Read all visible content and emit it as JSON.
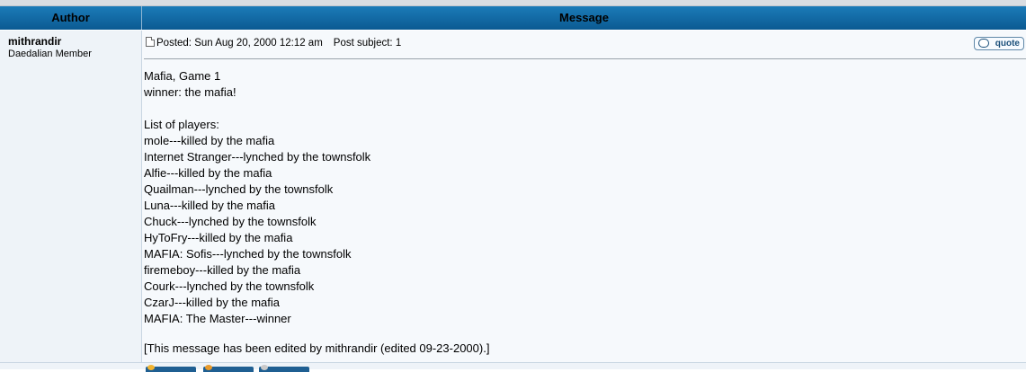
{
  "header": {
    "author_label": "Author",
    "message_label": "Message"
  },
  "post": {
    "author": "mithrandir",
    "rank": "Daedalian Member",
    "posted": "Posted: Sun Aug 20, 2000 12:12 am",
    "subject": "Post subject: 1",
    "quote_label": "quote",
    "lines": [
      "Mafia, Game 1",
      "winner: the mafia!",
      "",
      "List of players:",
      "mole---killed by the mafia",
      "Internet Stranger---lynched by the townsfolk",
      "Alfie---killed by the mafia",
      "Quailman---lynched by the townsfolk",
      "Luna---killed by the mafia",
      "Chuck---lynched by the townsfolk",
      "HyToFry---killed by the mafia",
      "MAFIA: Sofis---lynched by the townsfolk",
      "firemeboy---killed by the mafia",
      "Courk---lynched by the townsfolk",
      "CzarJ---killed by the mafia",
      "MAFIA: The Master---winner"
    ],
    "edited_note": "[This message has been edited by mithrandir (edited 09-23-2000).]"
  },
  "footer_icons": [
    "profile-icon",
    "pm-icon",
    "email-icon"
  ]
}
